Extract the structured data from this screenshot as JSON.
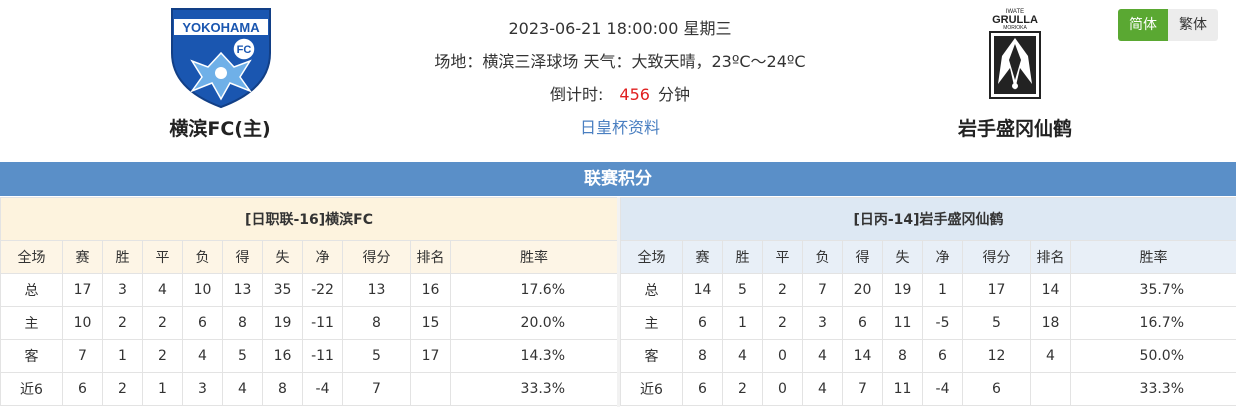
{
  "match": {
    "datetime": "2023-06-21 18:00:00 星期三",
    "venue_weather": "场地：横滨三泽球场 天气：大致天晴，23ºC～24ºC",
    "countdown_label": "倒计时:",
    "countdown_value": "456",
    "countdown_unit": "分钟",
    "cup_link": "日皇杯资料"
  },
  "home_team": {
    "name": "横滨FC(主)",
    "logo_text": "YOKOHAMA",
    "logo_badge": "FC"
  },
  "away_team": {
    "name": "岩手盛冈仙鹤",
    "logo_text": "GRULLA",
    "logo_top": "IWATE",
    "logo_sub": "MORIOKA"
  },
  "language": {
    "simplified": "简体",
    "traditional": "繁体"
  },
  "section_title": "联赛积分",
  "columns": [
    "全场",
    "赛",
    "胜",
    "平",
    "负",
    "得",
    "失",
    "净",
    "得分",
    "排名",
    "胜率"
  ],
  "home_table": {
    "title": "[日职联-16]横滨FC",
    "rows": [
      [
        "总",
        "17",
        "3",
        "4",
        "10",
        "13",
        "35",
        "-22",
        "13",
        "16",
        "17.6%"
      ],
      [
        "主",
        "10",
        "2",
        "2",
        "6",
        "8",
        "19",
        "-11",
        "8",
        "15",
        "20.0%"
      ],
      [
        "客",
        "7",
        "1",
        "2",
        "4",
        "5",
        "16",
        "-11",
        "5",
        "17",
        "14.3%"
      ],
      [
        "近6",
        "6",
        "2",
        "1",
        "3",
        "4",
        "8",
        "-4",
        "7",
        "",
        "33.3%"
      ]
    ]
  },
  "away_table": {
    "title": "[日丙-14]岩手盛冈仙鹤",
    "rows": [
      [
        "总",
        "14",
        "5",
        "2",
        "7",
        "20",
        "19",
        "1",
        "17",
        "14",
        "35.7%"
      ],
      [
        "主",
        "6",
        "1",
        "2",
        "3",
        "6",
        "11",
        "-5",
        "5",
        "18",
        "16.7%"
      ],
      [
        "客",
        "8",
        "4",
        "0",
        "4",
        "14",
        "8",
        "6",
        "12",
        "4",
        "50.0%"
      ],
      [
        "近6",
        "6",
        "2",
        "0",
        "4",
        "7",
        "11",
        "-4",
        "6",
        "",
        "33.3%"
      ]
    ]
  },
  "colors": {
    "section_bar": "#5a8fc8",
    "home_title_bg": "#fdf3de",
    "away_title_bg": "#dde8f3",
    "countdown": "#e02020",
    "link": "#4a7fc1",
    "lang_active": "#5aa832"
  }
}
